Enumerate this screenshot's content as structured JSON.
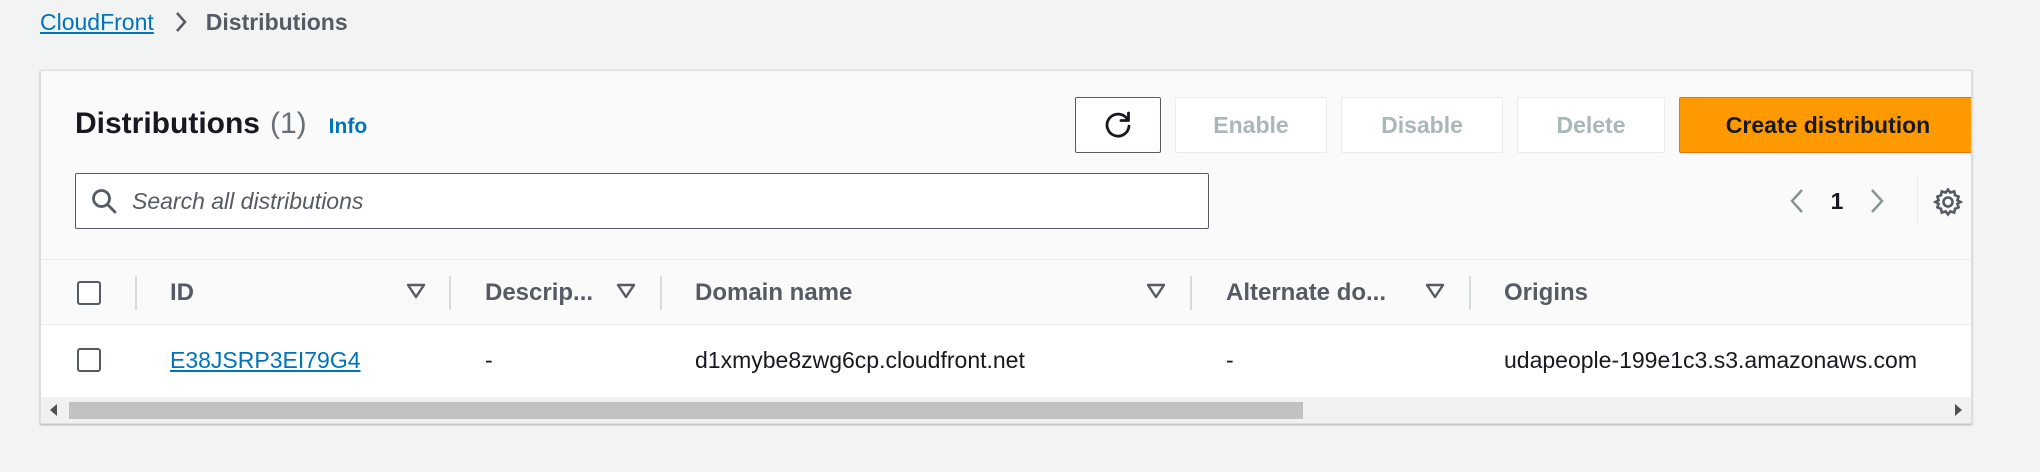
{
  "breadcrumb": {
    "parent": "CloudFront",
    "current": "Distributions"
  },
  "panel": {
    "title": "Distributions",
    "count": "(1)",
    "info": "Info"
  },
  "actions": {
    "refresh_icon": "refresh-icon",
    "enable": "Enable",
    "disable": "Disable",
    "delete": "Delete",
    "create": "Create distribution"
  },
  "search": {
    "placeholder": "Search all distributions",
    "value": ""
  },
  "pagination": {
    "current_page": "1"
  },
  "table": {
    "columns": [
      "ID",
      "Descrip...",
      "Domain name",
      "Alternate do...",
      "Origins"
    ],
    "rows": [
      {
        "id": "E38JSRP3EI79G4",
        "description": "-",
        "domain_name": "d1xmybe8zwg6cp.cloudfront.net",
        "alternate_domain": "-",
        "origins": "udapeople-199e1c3.s3.amazonaws.com"
      }
    ]
  },
  "colors": {
    "primary": "#ff9900",
    "link": "#0073bb",
    "background": "#f2f3f3"
  }
}
